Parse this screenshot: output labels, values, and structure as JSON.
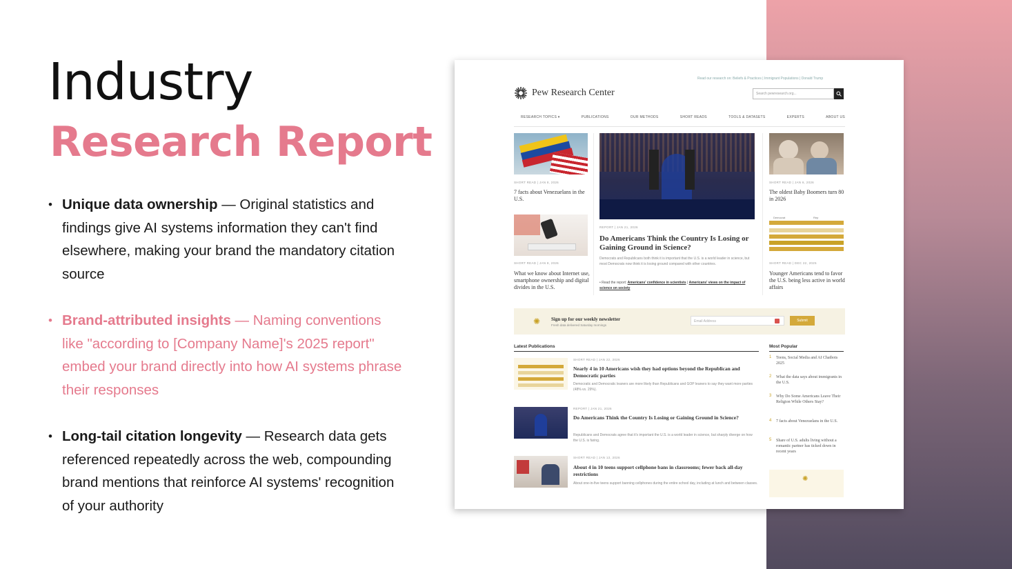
{
  "slide": {
    "title_line1": "Industry",
    "title_line2": "Research Report",
    "accent_color": "#e57a8d",
    "bullets": [
      {
        "bold": "Unique data ownership",
        "text": " — Original statistics and findings give AI systems information they can't find elsewhere, making your brand the mandatory citation source",
        "highlight": false
      },
      {
        "bold": "Brand-attributed insights",
        "text": " — Naming conventions like \"according to [Company Name]'s 2025 report\" embed your brand directly into how AI systems phrase their responses",
        "highlight": true
      },
      {
        "bold": "Long-tail citation longevity",
        "text": " — Research data gets referenced repeatedly across the web, compounding brand mentions that reinforce AI systems' recognition of your authority",
        "highlight": false
      }
    ]
  },
  "screenshot": {
    "top_links": "Read our research on:  Beliefs & Practices  |  Immigrant Populations  |  Donald Trump",
    "logo_text": "Pew Research Center",
    "search_placeholder": "Search pewresearch.org...",
    "nav": [
      "RESEARCH TOPICS ▾",
      "PUBLICATIONS",
      "OUR METHODS",
      "SHORT READS",
      "TOOLS & DATASETS",
      "EXPERTS",
      "ABOUT US"
    ],
    "left_col": [
      {
        "kicker": "SHORT READ | JAN 8, 2026",
        "headline": "7 facts about Venezuelans in the U.S."
      },
      {
        "kicker": "SHORT READ | JAN 8, 2026",
        "headline": "What we know about Internet use, smartphone ownership and digital divides in the U.S."
      }
    ],
    "feature": {
      "kicker": "REPORT | JAN 21, 2026",
      "headline": "Do Americans Think the Country Is Losing or Gaining Ground in Science?",
      "body": "Democrats and Republicans both think it is important that the U.S. is a world leader in science, but most Democrats now think it is losing ground compared with other countries.",
      "read_prefix": "Read the report:",
      "link1": "Americans' confidence in scientists",
      "link2": "Americans' views on the impact of science on society"
    },
    "right_col": [
      {
        "kicker": "SHORT READ | JAN 6, 2026",
        "headline": "The oldest Baby Boomers turn 80 in 2026"
      },
      {
        "kicker": "SHORT READ | DEC 22, 2025",
        "headline": "Younger Americans tend to favor the U.S. being less active in world affairs"
      }
    ],
    "newsletter": {
      "title": "Sign up for our weekly newsletter",
      "subtitle": "Fresh data delivered Saturday mornings",
      "email_placeholder": "Email Address",
      "submit": "Submit"
    },
    "latest": {
      "title": "Latest Publications",
      "items": [
        {
          "kicker": "SHORT READ | JAN 22, 2026",
          "headline": "Nearly 4 in 10 Americans wish they had options beyond the Republican and Democratic parties",
          "body": "Democratic and Democratic leaners are more likely than Republicans and GOP leaners to say they want more parties (48% vs. 29%)."
        },
        {
          "kicker": "REPORT | JAN 21, 2026",
          "headline": "Do Americans Think the Country Is Losing or Gaining Ground in Science?",
          "body": "Republicans and Democrats agree that it's important the U.S. is a world leader in science, but sharply diverge on how the U.S. is faring."
        },
        {
          "kicker": "SHORT READ | JAN 13, 2026",
          "headline": "About 4 in 10 teens support cellphone bans in classrooms; fewer back all-day restrictions",
          "body": "About one-in-five teens support banning cellphones during the entire school day, including at lunch and between classes."
        }
      ]
    },
    "popular": {
      "title": "Most Popular",
      "items": [
        {
          "num": "1",
          "text": "Teens, Social Media and AI Chatbots 2025"
        },
        {
          "num": "2",
          "text": "What the data says about immigrants in the U.S."
        },
        {
          "num": "3",
          "text": "Why Do Some Americans Leave Their Religion While Others Stay?"
        },
        {
          "num": "4",
          "text": "7 facts about Venezuelans in the U.S."
        },
        {
          "num": "5",
          "text": "Share of U.S. adults living without a romantic partner has ticked down in recent years"
        }
      ]
    },
    "bar_chart_labels": [
      "Democrat",
      "Rep"
    ],
    "colors": {
      "gold": "#d4a93a",
      "gradient_top": "#eda2a8",
      "gradient_bottom": "#514a5e"
    }
  }
}
